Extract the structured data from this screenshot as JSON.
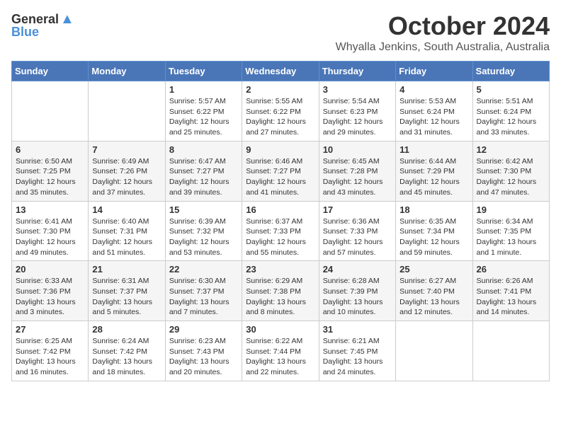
{
  "logo": {
    "general": "General",
    "blue": "Blue"
  },
  "title": "October 2024",
  "subtitle": "Whyalla Jenkins, South Australia, Australia",
  "days_of_week": [
    "Sunday",
    "Monday",
    "Tuesday",
    "Wednesday",
    "Thursday",
    "Friday",
    "Saturday"
  ],
  "weeks": [
    [
      {
        "day": "",
        "content": ""
      },
      {
        "day": "",
        "content": ""
      },
      {
        "day": "1",
        "content": "Sunrise: 5:57 AM\nSunset: 6:22 PM\nDaylight: 12 hours and 25 minutes."
      },
      {
        "day": "2",
        "content": "Sunrise: 5:55 AM\nSunset: 6:22 PM\nDaylight: 12 hours and 27 minutes."
      },
      {
        "day": "3",
        "content": "Sunrise: 5:54 AM\nSunset: 6:23 PM\nDaylight: 12 hours and 29 minutes."
      },
      {
        "day": "4",
        "content": "Sunrise: 5:53 AM\nSunset: 6:24 PM\nDaylight: 12 hours and 31 minutes."
      },
      {
        "day": "5",
        "content": "Sunrise: 5:51 AM\nSunset: 6:24 PM\nDaylight: 12 hours and 33 minutes."
      }
    ],
    [
      {
        "day": "6",
        "content": "Sunrise: 6:50 AM\nSunset: 7:25 PM\nDaylight: 12 hours and 35 minutes."
      },
      {
        "day": "7",
        "content": "Sunrise: 6:49 AM\nSunset: 7:26 PM\nDaylight: 12 hours and 37 minutes."
      },
      {
        "day": "8",
        "content": "Sunrise: 6:47 AM\nSunset: 7:27 PM\nDaylight: 12 hours and 39 minutes."
      },
      {
        "day": "9",
        "content": "Sunrise: 6:46 AM\nSunset: 7:27 PM\nDaylight: 12 hours and 41 minutes."
      },
      {
        "day": "10",
        "content": "Sunrise: 6:45 AM\nSunset: 7:28 PM\nDaylight: 12 hours and 43 minutes."
      },
      {
        "day": "11",
        "content": "Sunrise: 6:44 AM\nSunset: 7:29 PM\nDaylight: 12 hours and 45 minutes."
      },
      {
        "day": "12",
        "content": "Sunrise: 6:42 AM\nSunset: 7:30 PM\nDaylight: 12 hours and 47 minutes."
      }
    ],
    [
      {
        "day": "13",
        "content": "Sunrise: 6:41 AM\nSunset: 7:30 PM\nDaylight: 12 hours and 49 minutes."
      },
      {
        "day": "14",
        "content": "Sunrise: 6:40 AM\nSunset: 7:31 PM\nDaylight: 12 hours and 51 minutes."
      },
      {
        "day": "15",
        "content": "Sunrise: 6:39 AM\nSunset: 7:32 PM\nDaylight: 12 hours and 53 minutes."
      },
      {
        "day": "16",
        "content": "Sunrise: 6:37 AM\nSunset: 7:33 PM\nDaylight: 12 hours and 55 minutes."
      },
      {
        "day": "17",
        "content": "Sunrise: 6:36 AM\nSunset: 7:33 PM\nDaylight: 12 hours and 57 minutes."
      },
      {
        "day": "18",
        "content": "Sunrise: 6:35 AM\nSunset: 7:34 PM\nDaylight: 12 hours and 59 minutes."
      },
      {
        "day": "19",
        "content": "Sunrise: 6:34 AM\nSunset: 7:35 PM\nDaylight: 13 hours and 1 minute."
      }
    ],
    [
      {
        "day": "20",
        "content": "Sunrise: 6:33 AM\nSunset: 7:36 PM\nDaylight: 13 hours and 3 minutes."
      },
      {
        "day": "21",
        "content": "Sunrise: 6:31 AM\nSunset: 7:37 PM\nDaylight: 13 hours and 5 minutes."
      },
      {
        "day": "22",
        "content": "Sunrise: 6:30 AM\nSunset: 7:37 PM\nDaylight: 13 hours and 7 minutes."
      },
      {
        "day": "23",
        "content": "Sunrise: 6:29 AM\nSunset: 7:38 PM\nDaylight: 13 hours and 8 minutes."
      },
      {
        "day": "24",
        "content": "Sunrise: 6:28 AM\nSunset: 7:39 PM\nDaylight: 13 hours and 10 minutes."
      },
      {
        "day": "25",
        "content": "Sunrise: 6:27 AM\nSunset: 7:40 PM\nDaylight: 13 hours and 12 minutes."
      },
      {
        "day": "26",
        "content": "Sunrise: 6:26 AM\nSunset: 7:41 PM\nDaylight: 13 hours and 14 minutes."
      }
    ],
    [
      {
        "day": "27",
        "content": "Sunrise: 6:25 AM\nSunset: 7:42 PM\nDaylight: 13 hours and 16 minutes."
      },
      {
        "day": "28",
        "content": "Sunrise: 6:24 AM\nSunset: 7:42 PM\nDaylight: 13 hours and 18 minutes."
      },
      {
        "day": "29",
        "content": "Sunrise: 6:23 AM\nSunset: 7:43 PM\nDaylight: 13 hours and 20 minutes."
      },
      {
        "day": "30",
        "content": "Sunrise: 6:22 AM\nSunset: 7:44 PM\nDaylight: 13 hours and 22 minutes."
      },
      {
        "day": "31",
        "content": "Sunrise: 6:21 AM\nSunset: 7:45 PM\nDaylight: 13 hours and 24 minutes."
      },
      {
        "day": "",
        "content": ""
      },
      {
        "day": "",
        "content": ""
      }
    ]
  ]
}
